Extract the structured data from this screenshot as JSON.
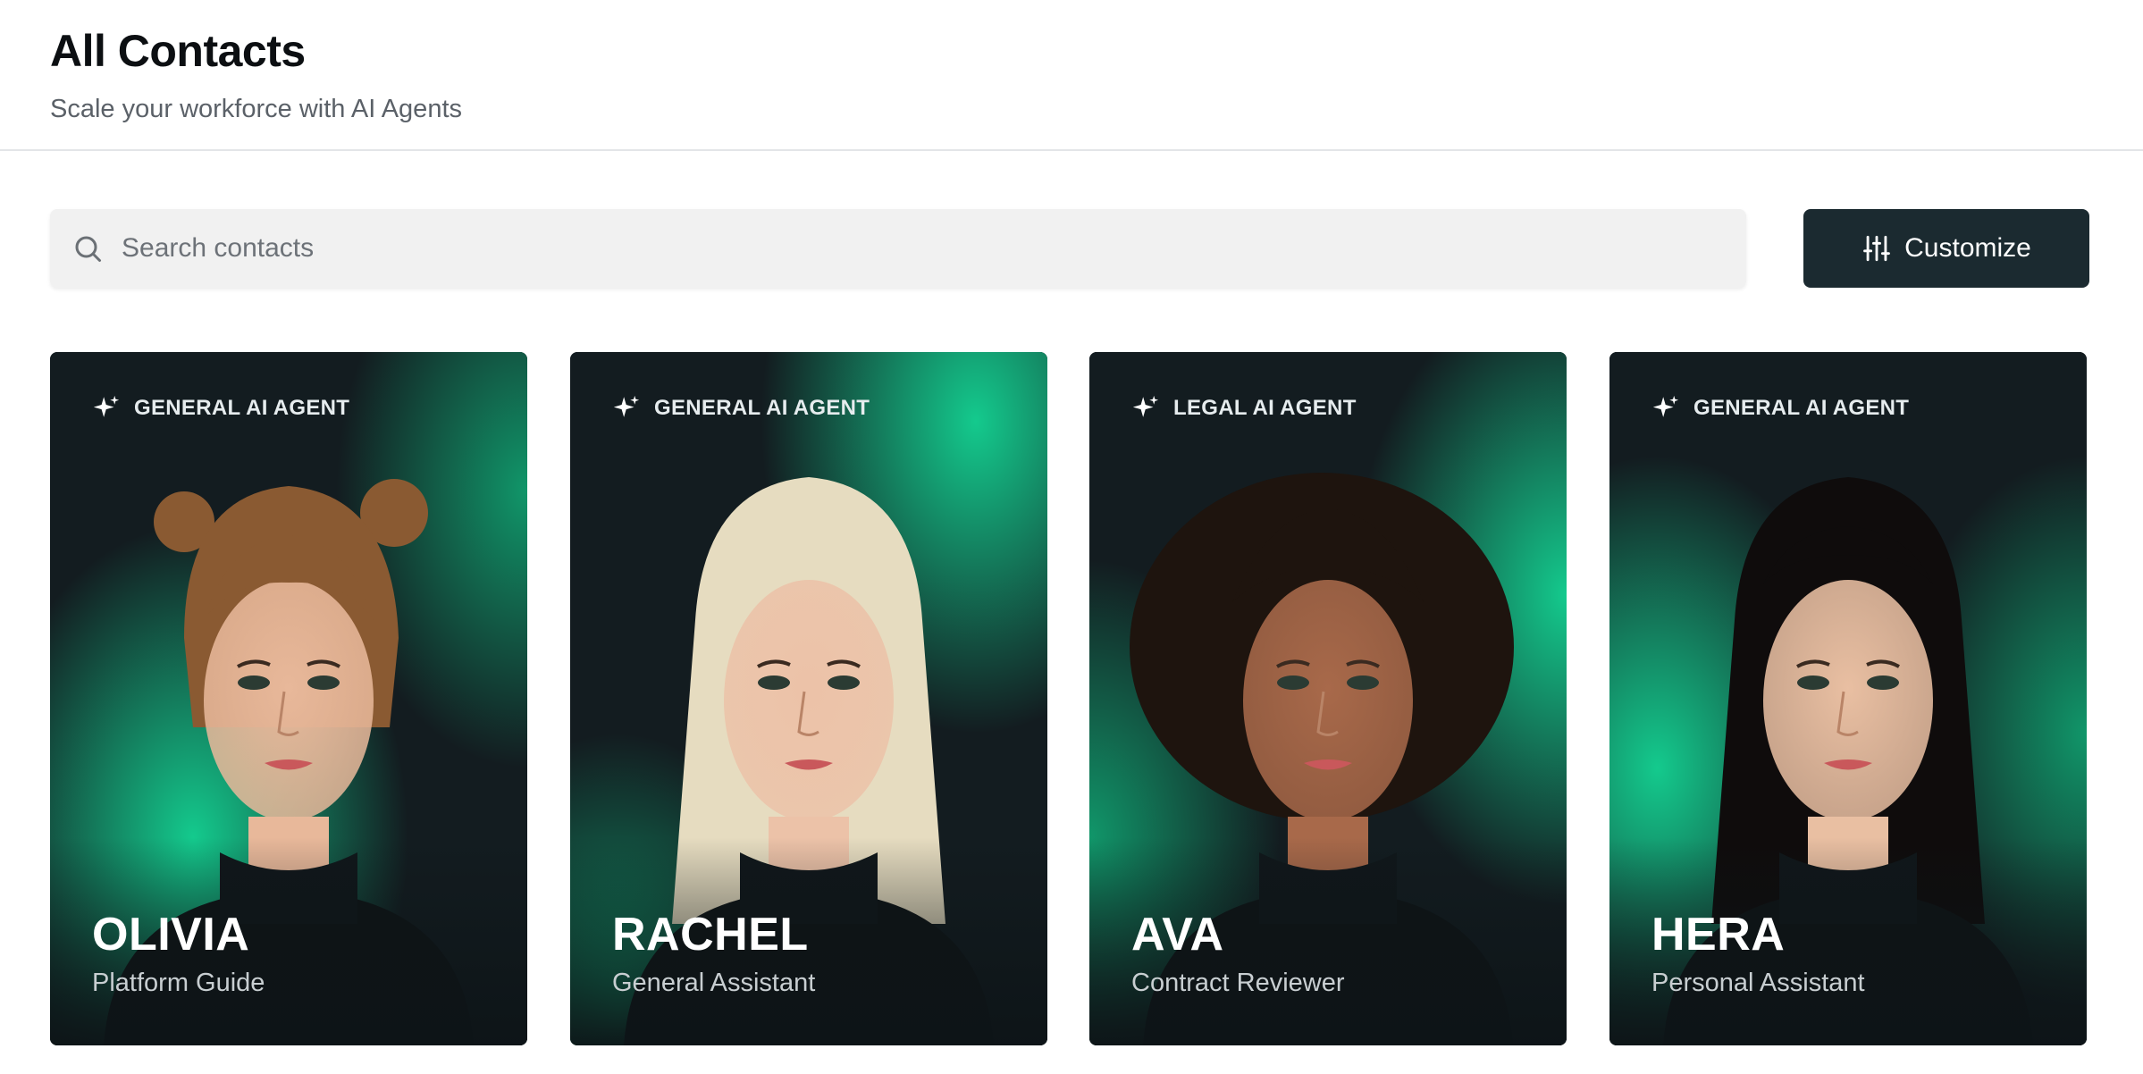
{
  "header": {
    "title": "All Contacts",
    "subtitle": "Scale your workforce with AI Agents"
  },
  "search": {
    "placeholder": "Search contacts",
    "value": "",
    "icon": "search-icon"
  },
  "toolbar": {
    "customize_label": "Customize",
    "customize_icon": "sliders-icon"
  },
  "colors": {
    "button_bg": "#1b2a30",
    "card_bg": "#121b1f",
    "accent_green": "#12c98a"
  },
  "contacts": [
    {
      "badge": "GENERAL AI AGENT",
      "badge_icon": "sparkle-icon",
      "name": "OLIVIA",
      "role": "Platform Guide",
      "hair": "#8a5a32",
      "skin": "#e8b89a"
    },
    {
      "badge": "GENERAL AI AGENT",
      "badge_icon": "sparkle-icon",
      "name": "RACHEL",
      "role": "General Assistant",
      "hair": "#e6dcc0",
      "skin": "#ecc2a8"
    },
    {
      "badge": "LEGAL AI AGENT",
      "badge_icon": "sparkle-icon",
      "name": "AVA",
      "role": "Contract Reviewer",
      "hair": "#1e140e",
      "skin": "#a8694a"
    },
    {
      "badge": "GENERAL AI AGENT",
      "badge_icon": "sparkle-icon",
      "name": "HERA",
      "role": "Personal Assistant",
      "hair": "#0f0c0c",
      "skin": "#e9bfa2"
    }
  ]
}
